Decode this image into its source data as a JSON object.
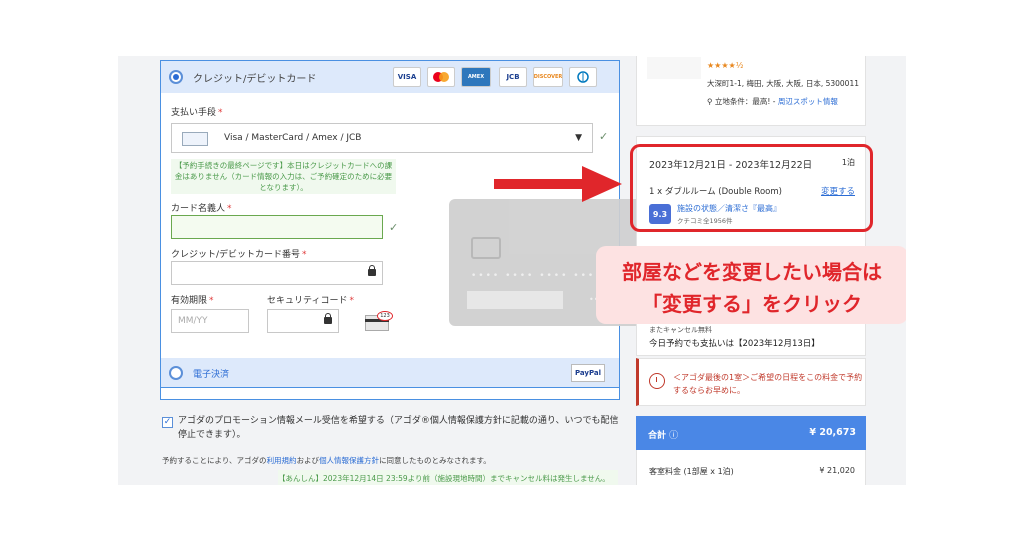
{
  "payment": {
    "card_option_label": "クレジット/デビットカード",
    "brands": [
      "VISA",
      "MasterCard",
      "AMERICAN EXPRESS",
      "JCB",
      "DISCOVER",
      "Diners Club"
    ],
    "method_label": "支払い手段",
    "method_value": "Visa / MasterCard / Amex / JCB",
    "note": "【予約手続きの最終ページです】本日はクレジットカードへの課金はありません（カード情報の入力は、ご予約確定のために必要となります）。",
    "cardholder_label": "カード名義人",
    "card_number_label": "クレジット/デビットカード番号",
    "expiry_label": "有効期限",
    "expiry_placeholder": "MM/YY",
    "security_label": "セキュリティコード",
    "cvv_badge": "123",
    "required_mark": "*",
    "ewallet_label": "電子決済",
    "paypal": "PayPal"
  },
  "promo": {
    "text": "アゴダのプロモーション情報メール受信を希望する（アゴダ®個人情報保護方針に記載の通り、いつでも配信停止できます）。",
    "checked_mark": "✓"
  },
  "agreement": {
    "prefix": "予約することにより、アゴダの",
    "terms_link": "利用規約",
    "middle": "および",
    "privacy_link": "個人情報保護方針",
    "suffix": "に同意したものとみなされます。"
  },
  "cancel_note": "【あんしん】2023年12月14日 23:59より前（施設現地時間）までキャンセル料は発生しません。",
  "hotel": {
    "stars": "★★★★½",
    "address": "大深町1-1, 梅田, 大阪, 大阪, 日本, 5300011",
    "location_prefix": "立地条件：最高! - ",
    "location_link": "周辺スポット情報"
  },
  "booking": {
    "dates": "2023年12月21日 - 2023年12月22日",
    "nights": "1泊",
    "room": "1 x ダブルルーム (Double Room)",
    "change_link": "変更する",
    "score": "9.3",
    "review_category": "施設の状態／清潔さ『最高』",
    "review_count": "クチコミ全1956件",
    "policy_hint": "またキャンセル無料",
    "pay_date": "今日予約でも支払いは【2023年12月13日】"
  },
  "alert": {
    "text": "＜アゴダ最後の1室＞ご希望の日程をこの料金で予約するならお早めに。"
  },
  "total": {
    "label": "合計",
    "value": "¥ 20,673"
  },
  "room_fee": {
    "label": "客室料金 (1部屋 x 1泊)",
    "value": "¥ 21,020"
  },
  "callout": {
    "line1": "部屋などを変更したい場合は",
    "line2": "「変更する」をクリック"
  },
  "colors": {
    "accent_red": "#e0262b",
    "link_blue": "#2b6cd4",
    "total_blue": "#4a87e6"
  }
}
